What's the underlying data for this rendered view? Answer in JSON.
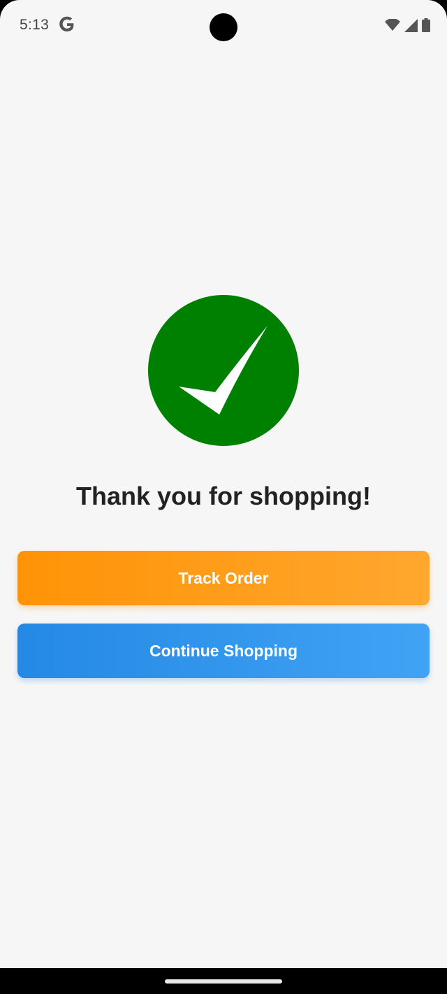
{
  "status_bar": {
    "time": "5:13",
    "google_icon": "google-g-icon",
    "wifi_icon": "wifi-icon",
    "signal_icon": "cell-signal-icon",
    "battery_icon": "battery-icon"
  },
  "success": {
    "icon": "checkmark-circle-icon",
    "icon_color": "#008000",
    "title": "Thank you for shopping!"
  },
  "actions": {
    "track_order_label": "Track Order",
    "track_order_color": "#ff9800",
    "continue_shopping_label": "Continue Shopping",
    "continue_shopping_color": "#2196f3"
  },
  "navigation": {
    "home_indicator_icon": "home-gesture-pill"
  }
}
